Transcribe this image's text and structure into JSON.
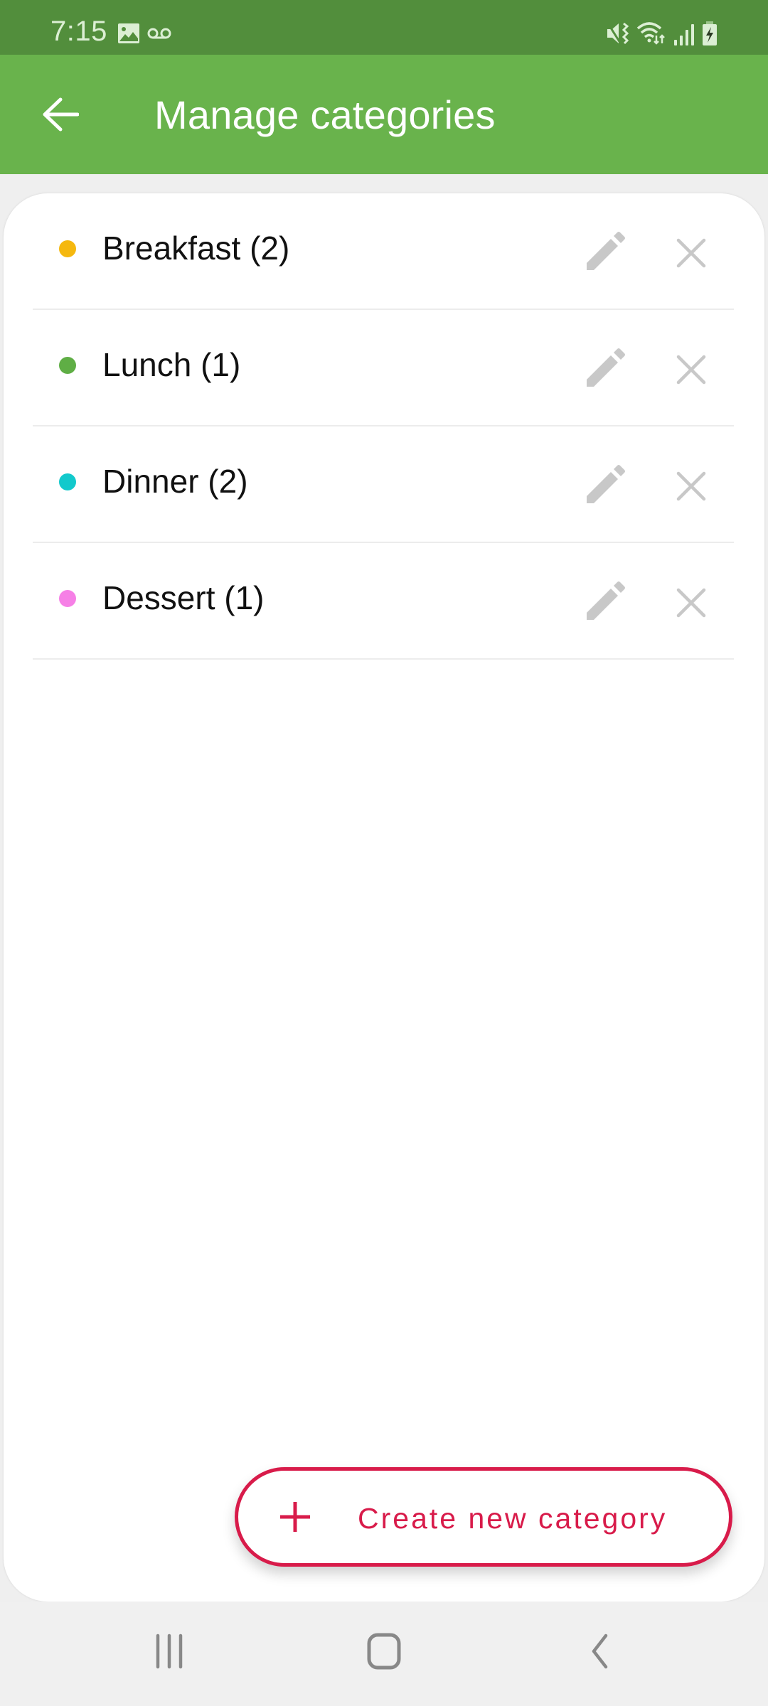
{
  "status_bar": {
    "time": "7:15",
    "left_icons": [
      "gallery-notification-icon",
      "voicemail-icon"
    ],
    "right_icons": [
      "vibrate-mute-icon",
      "wifi-icon",
      "cellular-signal-icon",
      "battery-charging-icon"
    ]
  },
  "app_bar": {
    "back_icon": "arrow-left-icon",
    "title": "Manage categories"
  },
  "categories": [
    {
      "label": "Breakfast (2)",
      "name": "Breakfast",
      "count": 2,
      "color": "#f5b80f"
    },
    {
      "label": "Lunch (1)",
      "name": "Lunch",
      "count": 1,
      "color": "#5fae45"
    },
    {
      "label": "Dinner (2)",
      "name": "Dinner",
      "count": 2,
      "color": "#12c9cc"
    },
    {
      "label": "Dessert (1)",
      "name": "Dessert",
      "count": 1,
      "color": "#f680e6"
    }
  ],
  "row_actions": {
    "edit_icon": "pencil-icon",
    "delete_icon": "close-icon"
  },
  "create_button": {
    "icon": "plus-icon",
    "label": "Create new category",
    "color": "#d81b4a"
  },
  "nav_bar": {
    "recents_icon": "recents-icon",
    "home_icon": "home-icon",
    "back_icon": "back-chevron-icon"
  },
  "colors": {
    "status_bar": "#528e3c",
    "app_bar": "#69b34c",
    "background": "#efefef",
    "icon_gray": "#c8c8c8"
  }
}
